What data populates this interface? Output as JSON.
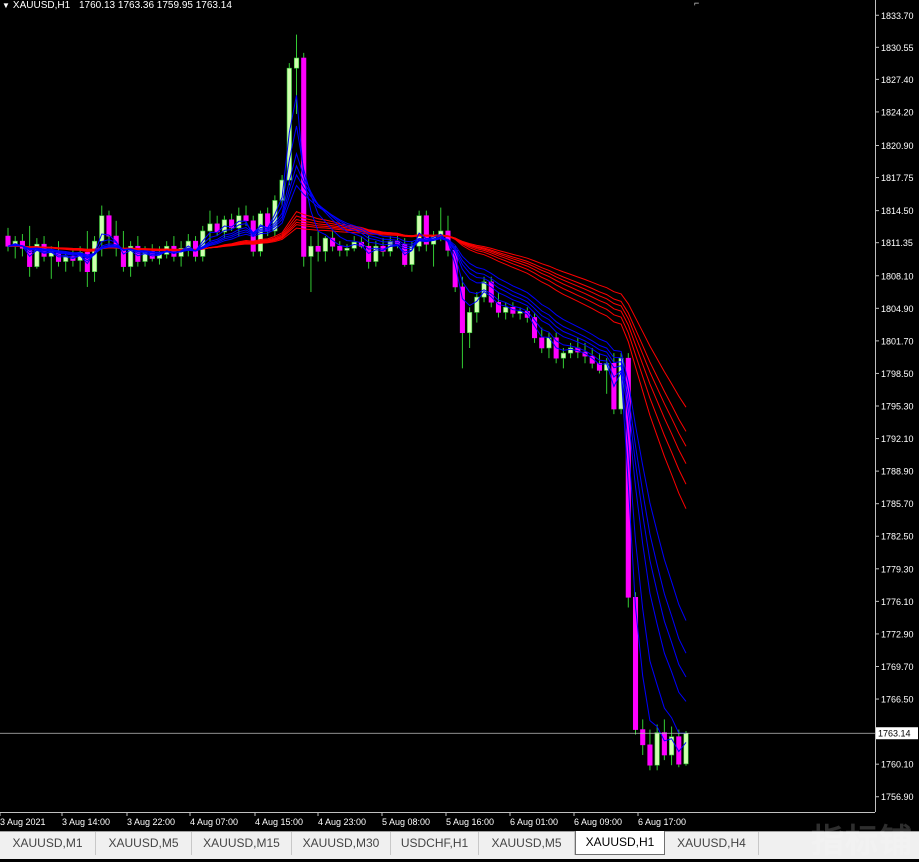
{
  "header": {
    "symbol_label": "XAUUSD,H1",
    "ohlc": "1760.13 1763.36 1759.95 1763.14",
    "dropdown_icon": "triangle-down-icon"
  },
  "chart_data": {
    "type": "candlestick",
    "symbol": "XAUUSD",
    "timeframe": "H1",
    "yaxis_ticks": [
      "1833.70",
      "1830.55",
      "1827.40",
      "1824.20",
      "1820.90",
      "1817.75",
      "1814.50",
      "1811.35",
      "1808.10",
      "1804.90",
      "1801.70",
      "1798.50",
      "1795.30",
      "1792.10",
      "1788.90",
      "1785.70",
      "1782.50",
      "1779.30",
      "1776.10",
      "1772.90",
      "1769.70",
      "1766.50",
      "1763.14",
      "1760.10",
      "1756.90"
    ],
    "ylim": [
      1756.9,
      1833.7
    ],
    "current_price": "1763.14",
    "xaxis_ticks": [
      "3 Aug 2021",
      "3 Aug 14:00",
      "3 Aug 22:00",
      "4 Aug 07:00",
      "4 Aug 15:00",
      "4 Aug 23:00",
      "5 Aug 08:00",
      "5 Aug 16:00",
      "6 Aug 01:00",
      "6 Aug 09:00",
      "6 Aug 17:00"
    ],
    "candles": [
      [
        1812.0,
        1812.8,
        1810.5,
        1811.0
      ],
      [
        1811.0,
        1812.0,
        1809.8,
        1811.5
      ],
      [
        1811.5,
        1812.2,
        1810.0,
        1810.8
      ],
      [
        1810.8,
        1813.0,
        1808.0,
        1809.0
      ],
      [
        1809.0,
        1811.8,
        1808.8,
        1811.2
      ],
      [
        1811.2,
        1812.0,
        1809.5,
        1810.0
      ],
      [
        1810.0,
        1811.0,
        1807.8,
        1810.5
      ],
      [
        1810.5,
        1811.5,
        1809.0,
        1809.5
      ],
      [
        1809.5,
        1810.5,
        1808.5,
        1810.0
      ],
      [
        1810.0,
        1810.8,
        1809.0,
        1809.6
      ],
      [
        1809.6,
        1811.0,
        1808.5,
        1810.4
      ],
      [
        1810.4,
        1812.5,
        1807.0,
        1808.5
      ],
      [
        1808.5,
        1812.0,
        1807.5,
        1811.5
      ],
      [
        1811.5,
        1815.0,
        1810.0,
        1814.0
      ],
      [
        1814.0,
        1814.5,
        1811.0,
        1812.0
      ],
      [
        1812.0,
        1813.5,
        1810.0,
        1810.8
      ],
      [
        1810.8,
        1812.5,
        1808.5,
        1809.0
      ],
      [
        1809.0,
        1811.5,
        1808.0,
        1811.0
      ],
      [
        1811.0,
        1812.0,
        1809.0,
        1809.5
      ],
      [
        1809.5,
        1811.0,
        1809.0,
        1810.5
      ],
      [
        1810.5,
        1811.2,
        1809.5,
        1809.8
      ],
      [
        1809.8,
        1811.0,
        1809.2,
        1810.2
      ],
      [
        1810.2,
        1811.5,
        1809.8,
        1811.0
      ],
      [
        1811.0,
        1812.0,
        1809.5,
        1810.0
      ],
      [
        1810.0,
        1811.5,
        1809.0,
        1810.8
      ],
      [
        1810.8,
        1812.2,
        1810.0,
        1811.5
      ],
      [
        1811.5,
        1812.0,
        1809.5,
        1810.0
      ],
      [
        1810.0,
        1813.0,
        1809.5,
        1812.5
      ],
      [
        1812.5,
        1814.5,
        1811.5,
        1813.2
      ],
      [
        1813.2,
        1814.0,
        1812.0,
        1812.4
      ],
      [
        1812.4,
        1814.0,
        1811.8,
        1813.6
      ],
      [
        1813.6,
        1814.2,
        1812.5,
        1812.8
      ],
      [
        1812.8,
        1814.8,
        1812.0,
        1814.0
      ],
      [
        1814.0,
        1815.0,
        1813.0,
        1813.5
      ],
      [
        1813.5,
        1814.0,
        1810.0,
        1810.5
      ],
      [
        1810.5,
        1814.5,
        1810.0,
        1814.2
      ],
      [
        1814.2,
        1814.8,
        1812.0,
        1812.5
      ],
      [
        1812.5,
        1816.0,
        1812.0,
        1815.5
      ],
      [
        1815.5,
        1818.0,
        1815.0,
        1817.5
      ],
      [
        1817.5,
        1829.0,
        1817.0,
        1828.5
      ],
      [
        1828.5,
        1831.8,
        1824.0,
        1829.5
      ],
      [
        1829.5,
        1830.0,
        1809.0,
        1810.0
      ],
      [
        1810.0,
        1812.0,
        1806.5,
        1811.0
      ],
      [
        1811.0,
        1812.5,
        1809.5,
        1810.5
      ],
      [
        1810.5,
        1812.0,
        1809.5,
        1811.8
      ],
      [
        1811.8,
        1812.5,
        1810.5,
        1811.0
      ],
      [
        1811.0,
        1811.5,
        1810.0,
        1810.6
      ],
      [
        1810.6,
        1811.2,
        1810.0,
        1810.8
      ],
      [
        1810.8,
        1812.0,
        1810.5,
        1811.4
      ],
      [
        1811.4,
        1812.0,
        1810.8,
        1811.0
      ],
      [
        1811.0,
        1812.0,
        1808.8,
        1809.5
      ],
      [
        1809.5,
        1811.5,
        1809.0,
        1811.0
      ],
      [
        1811.0,
        1811.8,
        1810.0,
        1810.5
      ],
      [
        1810.5,
        1812.0,
        1810.0,
        1811.5
      ],
      [
        1811.5,
        1812.0,
        1810.8,
        1811.2
      ],
      [
        1811.2,
        1811.8,
        1809.0,
        1809.2
      ],
      [
        1809.2,
        1811.5,
        1808.5,
        1811.0
      ],
      [
        1811.0,
        1814.5,
        1810.5,
        1814.0
      ],
      [
        1814.0,
        1814.5,
        1810.5,
        1811.2
      ],
      [
        1811.2,
        1812.5,
        1809.0,
        1812.0
      ],
      [
        1812.0,
        1814.8,
        1811.5,
        1812.5
      ],
      [
        1812.5,
        1814.0,
        1810.0,
        1810.6
      ],
      [
        1810.6,
        1811.0,
        1806.5,
        1807.0
      ],
      [
        1807.0,
        1808.0,
        1799.0,
        1802.5
      ],
      [
        1802.5,
        1805.0,
        1801.0,
        1804.5
      ],
      [
        1804.5,
        1806.5,
        1803.5,
        1806.0
      ],
      [
        1806.0,
        1808.0,
        1805.5,
        1807.5
      ],
      [
        1807.5,
        1808.0,
        1805.0,
        1805.5
      ],
      [
        1805.5,
        1806.5,
        1804.0,
        1804.5
      ],
      [
        1804.5,
        1805.5,
        1803.8,
        1805.0
      ],
      [
        1805.0,
        1805.5,
        1804.0,
        1804.4
      ],
      [
        1804.4,
        1805.0,
        1803.8,
        1804.6
      ],
      [
        1804.6,
        1805.0,
        1803.5,
        1804.0
      ],
      [
        1804.0,
        1804.5,
        1801.5,
        1802.0
      ],
      [
        1802.0,
        1803.0,
        1800.5,
        1801.0
      ],
      [
        1801.0,
        1802.5,
        1800.0,
        1802.0
      ],
      [
        1802.0,
        1802.5,
        1799.5,
        1800.0
      ],
      [
        1800.0,
        1801.0,
        1799.0,
        1800.5
      ],
      [
        1800.5,
        1801.5,
        1800.0,
        1801.0
      ],
      [
        1801.0,
        1802.0,
        1800.0,
        1800.6
      ],
      [
        1800.6,
        1801.5,
        1799.5,
        1800.2
      ],
      [
        1800.2,
        1801.0,
        1799.0,
        1799.5
      ],
      [
        1799.5,
        1800.5,
        1798.5,
        1798.8
      ],
      [
        1798.8,
        1800.0,
        1796.5,
        1799.5
      ],
      [
        1799.5,
        1800.5,
        1794.5,
        1795.0
      ],
      [
        1795.0,
        1800.5,
        1794.5,
        1800.0
      ],
      [
        1800.0,
        1800.5,
        1775.5,
        1776.5
      ],
      [
        1776.5,
        1777.0,
        1763.0,
        1763.5
      ],
      [
        1763.5,
        1764.5,
        1761.0,
        1762.0
      ],
      [
        1762.0,
        1763.5,
        1759.5,
        1760.0
      ],
      [
        1760.0,
        1764.0,
        1759.5,
        1763.2
      ],
      [
        1763.2,
        1764.5,
        1760.5,
        1761.0
      ],
      [
        1761.0,
        1763.8,
        1760.0,
        1762.8
      ],
      [
        1762.8,
        1763.5,
        1759.8,
        1760.1
      ],
      [
        1760.13,
        1763.36,
        1759.95,
        1763.14
      ]
    ]
  },
  "colors": {
    "background": "#000000",
    "bull_candle": "#d0ffb0",
    "bear_candle": "#ff00ff",
    "wick": "#33cc33",
    "ma_fast": "#0000ff",
    "ma_slow": "#ff0000",
    "axis_text": "#ffffff",
    "grid": "#c0c0c0"
  },
  "tabs": [
    {
      "label": "XAUUSD,M1",
      "active": false
    },
    {
      "label": "XAUUSD,M5",
      "active": false
    },
    {
      "label": "XAUUSD,M15",
      "active": false
    },
    {
      "label": "XAUUSD,M30",
      "active": false
    },
    {
      "label": "USDCHF,H1",
      "active": false
    },
    {
      "label": "XAUUSD,M5",
      "active": false
    },
    {
      "label": "XAUUSD,H1",
      "active": true
    },
    {
      "label": "XAUUSD,H4",
      "active": false
    }
  ],
  "watermark": "指标铺"
}
